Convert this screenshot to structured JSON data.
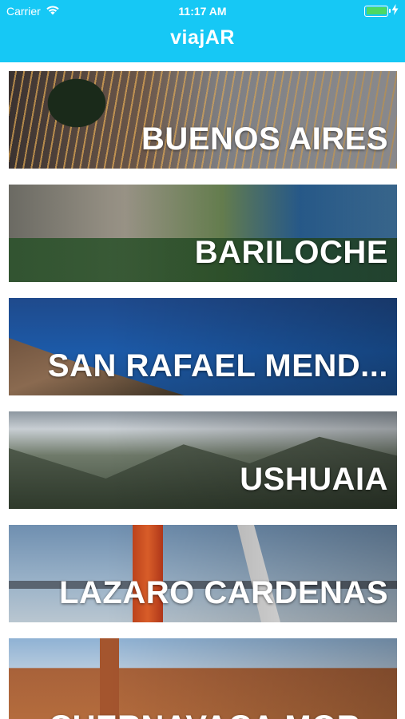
{
  "status_bar": {
    "carrier": "Carrier",
    "time": "11:17 AM",
    "battery_level": 1.0
  },
  "nav": {
    "title": "viajAR"
  },
  "destinations": [
    {
      "label": "BUENOS AIRES"
    },
    {
      "label": "BARILOCHE"
    },
    {
      "label": "SAN RAFAEL MEND..."
    },
    {
      "label": "USHUAIA"
    },
    {
      "label": "LAZARO CARDENAS"
    },
    {
      "label": "CUERNAVACA,MOR..."
    }
  ],
  "colors": {
    "header": "#16c8f5",
    "battery": "#4cd964"
  },
  "icons": {
    "wifi": "wifi-icon",
    "battery": "battery-icon",
    "charging": "charging-bolt-icon"
  }
}
